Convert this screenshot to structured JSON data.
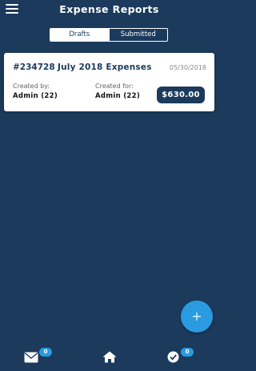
{
  "header": {
    "title": "Expense Reports",
    "menu_icon": "hamburger-menu-icon"
  },
  "tabs": [
    {
      "label": "Drafts",
      "active": true
    },
    {
      "label": "Submitted",
      "active": false
    }
  ],
  "reports": [
    {
      "id": "#234728",
      "name": "July 2018 Expenses",
      "date": "05/30/2018",
      "created_by_label": "Created by:",
      "created_by": "Admin (22)",
      "created_for_label": "Created for:",
      "created_for": "Admin (22)",
      "amount": "$630.00"
    }
  ],
  "fab": {
    "icon": "plus-icon"
  },
  "bottom_nav": {
    "mail": {
      "icon": "envelope-icon",
      "badge": "0"
    },
    "home": {
      "icon": "home-icon"
    },
    "approvals": {
      "icon": "check-circle-icon",
      "badge": "0"
    }
  },
  "colors": {
    "background": "#1b3a5c",
    "accent": "#2a9be0",
    "card": "#ffffff"
  }
}
